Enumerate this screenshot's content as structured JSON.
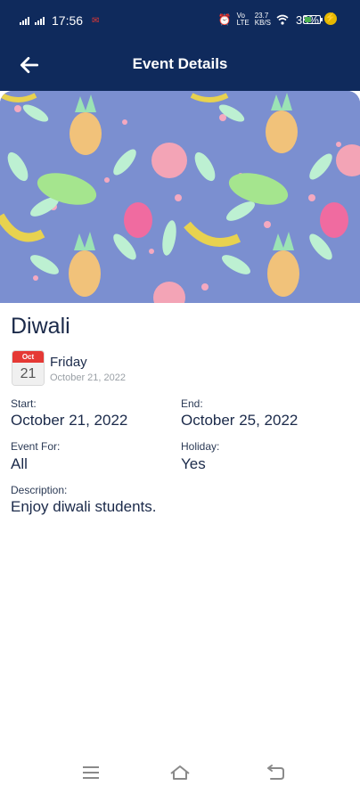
{
  "status_bar": {
    "time": "17:56",
    "wifi_label_top": "Vo",
    "wifi_label_bottom": "LTE",
    "data_rate_top": "23.7",
    "data_rate_bottom": "KB/S",
    "battery_percent": "38%",
    "battery_level": 0.38,
    "accent_green": "#4caf50"
  },
  "header": {
    "title": "Event Details",
    "back_icon": "arrow-left-icon",
    "color": "#0f2a5c"
  },
  "event": {
    "title": "Diwali",
    "calendar_month": "Oct",
    "calendar_day": "21",
    "weekday": "Friday",
    "date_full": "October 21, 2022",
    "start_label": "Start:",
    "start_value": "October 21, 2022",
    "end_label": "End:",
    "end_value": "October 25, 2022",
    "event_for_label": "Event For:",
    "event_for_value": "All",
    "holiday_label": "Holiday:",
    "holiday_value": "Yes",
    "description_label": "Description:",
    "description_value": "Enjoy diwali students."
  },
  "nav_bar": {
    "icons": [
      "menu-icon",
      "home-icon",
      "back-icon"
    ]
  }
}
